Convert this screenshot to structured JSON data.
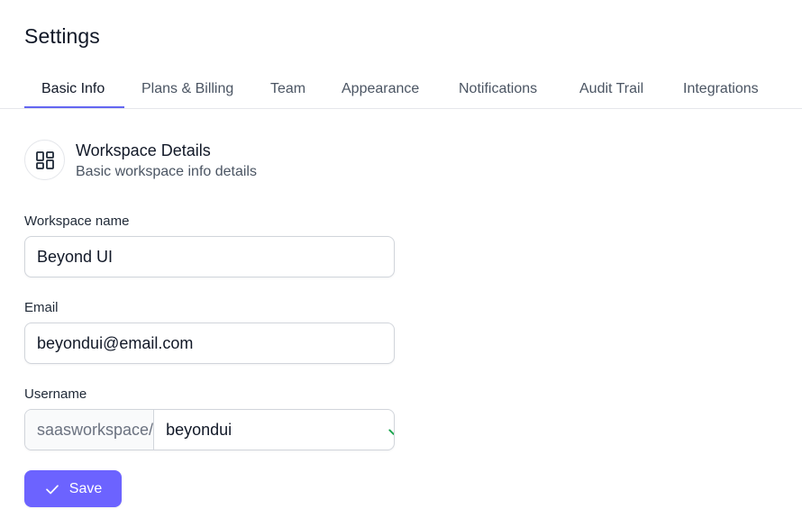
{
  "page": {
    "title": "Settings"
  },
  "tabs": [
    {
      "label": "Basic Info",
      "active": true
    },
    {
      "label": "Plans & Billing",
      "active": false
    },
    {
      "label": "Team",
      "active": false
    },
    {
      "label": "Appearance",
      "active": false
    },
    {
      "label": "Notifications",
      "active": false
    },
    {
      "label": "Audit Trail",
      "active": false
    },
    {
      "label": "Integrations",
      "active": false
    }
  ],
  "section": {
    "icon": "layout-grid-icon",
    "title": "Workspace Details",
    "subtitle": "Basic workspace info details"
  },
  "form": {
    "workspace_name": {
      "label": "Workspace name",
      "value": "Beyond UI"
    },
    "email": {
      "label": "Email",
      "value": "beyondui@email.com"
    },
    "username": {
      "label": "Username",
      "prefix": "saasworkspace/",
      "value": "beyondui",
      "status_icon": "check-icon"
    }
  },
  "actions": {
    "save_label": "Save",
    "save_icon": "check-icon"
  },
  "colors": {
    "accent": "#6C63FF",
    "tab_indicator": "#6366F1",
    "success": "#16A34A"
  }
}
